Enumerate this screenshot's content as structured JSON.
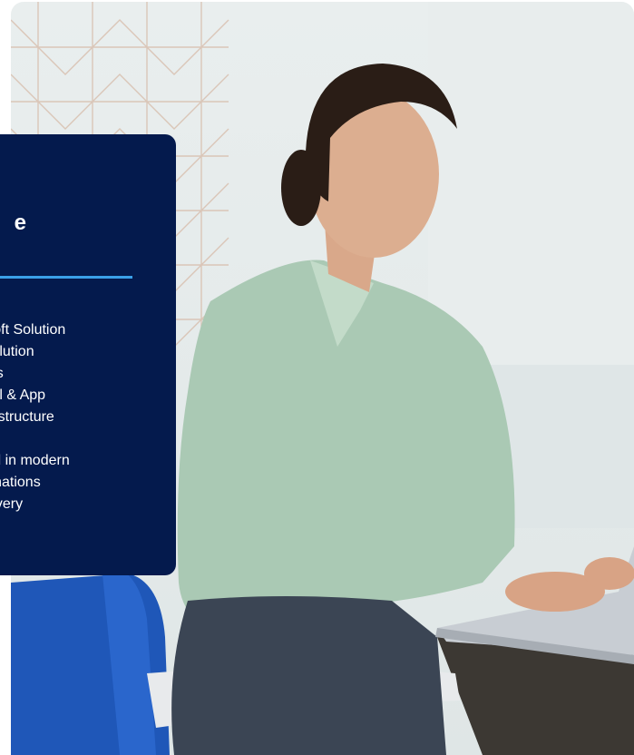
{
  "card": {
    "heading_visible": "e",
    "lines_group_1": [
      "rosoft Solution",
      "x solution",
      "ness",
      "igital & App",
      "nfrastructure"
    ],
    "lines_group_2": [
      "cord in modern",
      "formations",
      " delivery"
    ]
  },
  "colors": {
    "card_background": "#041a4d",
    "card_rule": "#3aa0e8",
    "card_text": "#ffffff"
  },
  "photo": {
    "subject": "woman-working-on-laptop"
  }
}
